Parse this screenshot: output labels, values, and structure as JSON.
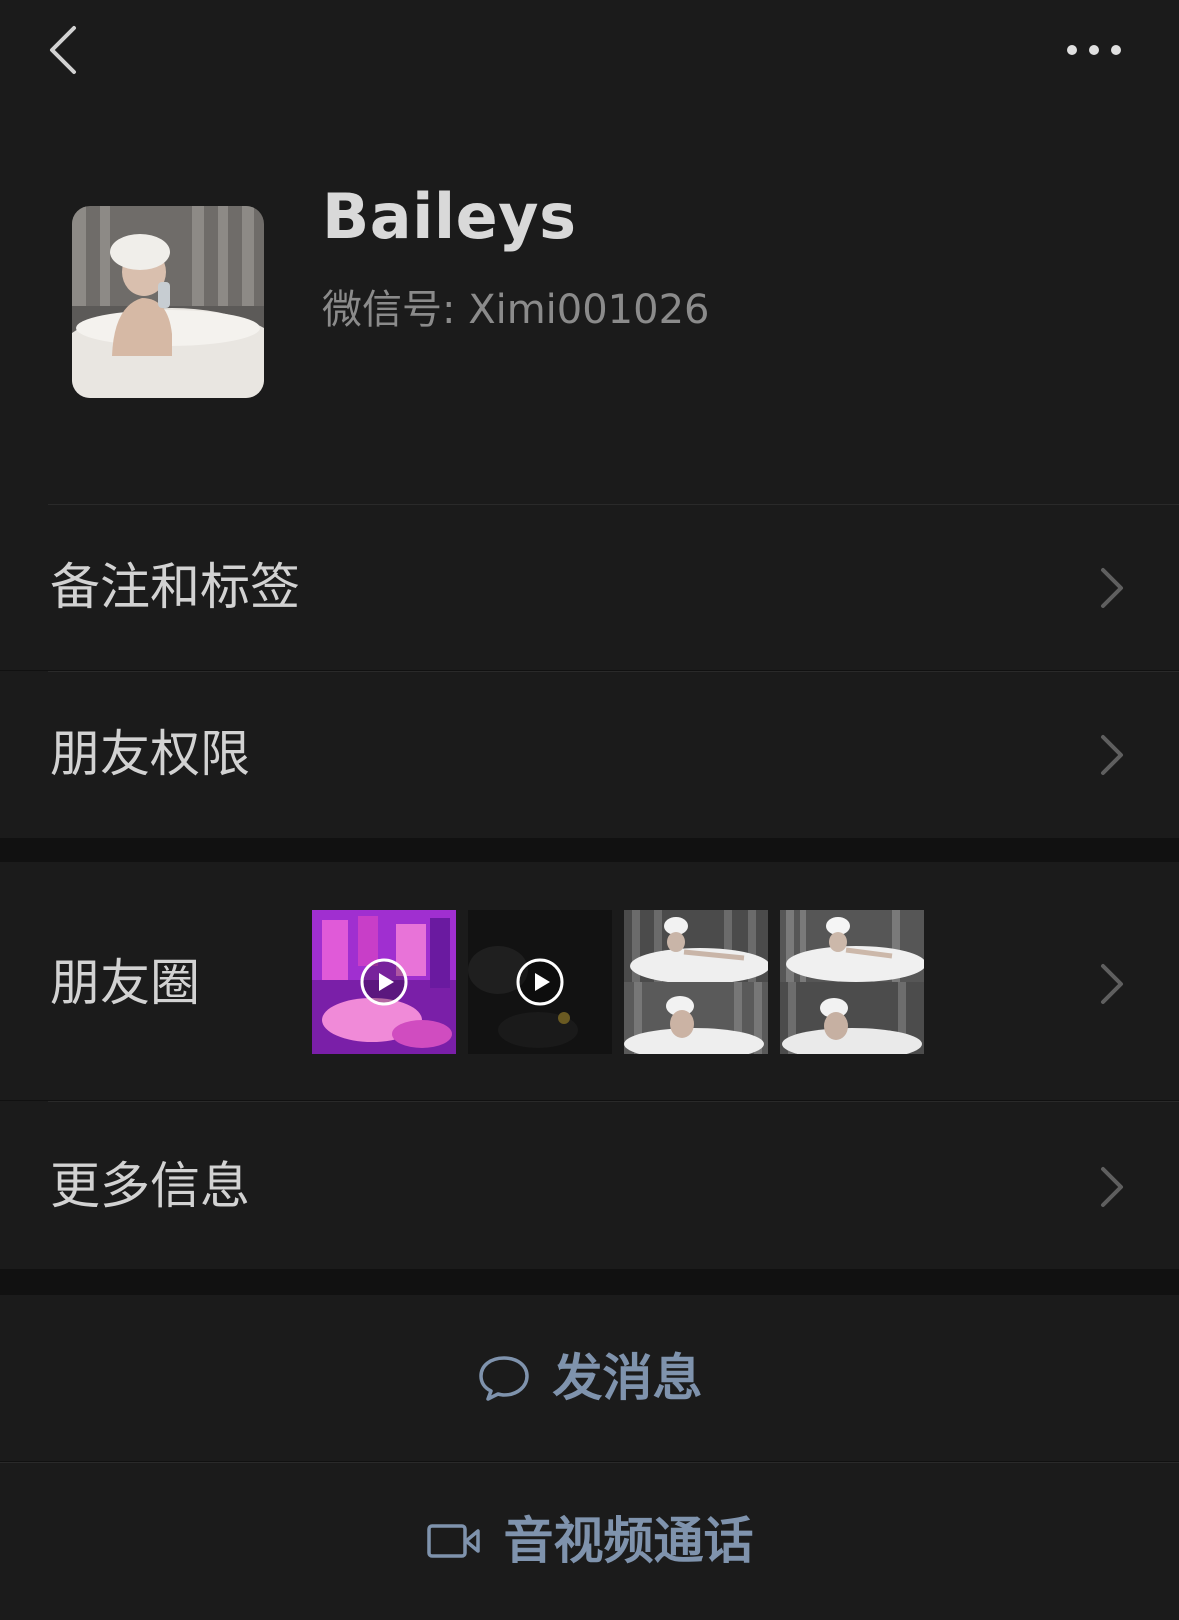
{
  "nav": {
    "back_icon": "chevron-left-icon",
    "more_icon": "ellipsis-icon"
  },
  "profile": {
    "name": "Baileys",
    "wechat_id": "微信号: Ximi001026"
  },
  "rows": [
    {
      "label": "备注和标签"
    },
    {
      "label": "朋友权限"
    },
    {
      "label": "朋友圈"
    },
    {
      "label": "更多信息"
    }
  ],
  "moments_thumbnails": [
    {
      "kind": "video",
      "tone": "purple"
    },
    {
      "kind": "video",
      "tone": "dark"
    },
    {
      "kind": "image",
      "tone": "bath"
    },
    {
      "kind": "image",
      "tone": "bath"
    }
  ],
  "actions": {
    "send_message": "发消息",
    "av_call": "音视频通话"
  },
  "colors": {
    "background": "#111111",
    "panel": "#1b1b1b",
    "action_text": "#7f93ad",
    "secondary_text": "#8b8b8b"
  }
}
